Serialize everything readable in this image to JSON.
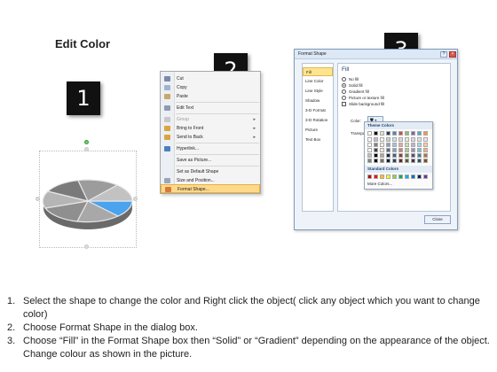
{
  "title": "Edit Color",
  "steps": {
    "badge1": "1",
    "badge2": "2",
    "badge3": "3"
  },
  "context_menu": {
    "items": [
      {
        "label": "Cut",
        "icon": "scissors-icon",
        "enabled": true
      },
      {
        "label": "Copy",
        "icon": "copy-icon",
        "enabled": true
      },
      {
        "label": "Paste",
        "icon": "paste-icon",
        "enabled": true
      },
      {
        "label": "Edit Text",
        "icon": "text-box-icon",
        "enabled": true
      },
      {
        "label": "Group",
        "icon": "group-icon",
        "enabled": false
      },
      {
        "label": "Bring to Front",
        "icon": "bring-front-icon",
        "enabled": true
      },
      {
        "label": "Send to Back",
        "icon": "send-back-icon",
        "enabled": true
      },
      {
        "label": "Hyperlink...",
        "icon": "hyperlink-icon",
        "enabled": true
      },
      {
        "label": "Save as Picture...",
        "icon": "",
        "enabled": true
      },
      {
        "label": "Set as Default Shape",
        "icon": "",
        "enabled": true
      },
      {
        "label": "Size and Position...",
        "icon": "size-icon",
        "enabled": true
      },
      {
        "label": "Format Shape...",
        "icon": "format-shape-icon",
        "enabled": true,
        "highlighted": true
      }
    ]
  },
  "dialog": {
    "title": "Format Shape",
    "nav": [
      "Fill",
      "Line Color",
      "Line Style",
      "Shadow",
      "3-D Format",
      "3-D Rotation",
      "Picture",
      "Text Box"
    ],
    "section_title": "Fill",
    "options": [
      {
        "label": "No fill",
        "type": "radio",
        "checked": false
      },
      {
        "label": "Solid fill",
        "type": "radio",
        "checked": true
      },
      {
        "label": "Gradient fill",
        "type": "radio",
        "checked": false
      },
      {
        "label": "Picture or texture fill",
        "type": "radio",
        "checked": false
      },
      {
        "label": "Slide background fill",
        "type": "checkbox",
        "checked": false
      }
    ],
    "color_label": "Color:",
    "transparency_label": "Transpa",
    "close_label": "Close",
    "palette": {
      "theme_header": "Theme Colors",
      "standard_header": "Standard Colors",
      "more_label": "More Colors...",
      "theme_top_row": [
        "#ffffff",
        "#000000",
        "#e8e0c8",
        "#1f3864",
        "#4f81bd",
        "#c0504d",
        "#9bbb59",
        "#8064a2",
        "#4bacc6",
        "#f79646"
      ],
      "standard_row": [
        "#c00000",
        "#ff0000",
        "#ffc000",
        "#ffff00",
        "#92d050",
        "#00b050",
        "#00b0f0",
        "#0070c0",
        "#002060",
        "#7030a0"
      ]
    }
  },
  "instructions": [
    {
      "num": "1.",
      "text": "Select the shape to change the color and Right click the object( click any object which you want to change color)"
    },
    {
      "num": "2.",
      "text": "Choose Format Shape in the dialog box."
    },
    {
      "num": "3.",
      "text": "Choose “Fill” in the Format Shape box then “Solid” or “Gradient” depending on the appearance of the object. Change colour as shown in the picture."
    }
  ],
  "colors": {
    "pie_highlight": "#4aa3ee",
    "menu_highlight": "#ffd98a"
  }
}
